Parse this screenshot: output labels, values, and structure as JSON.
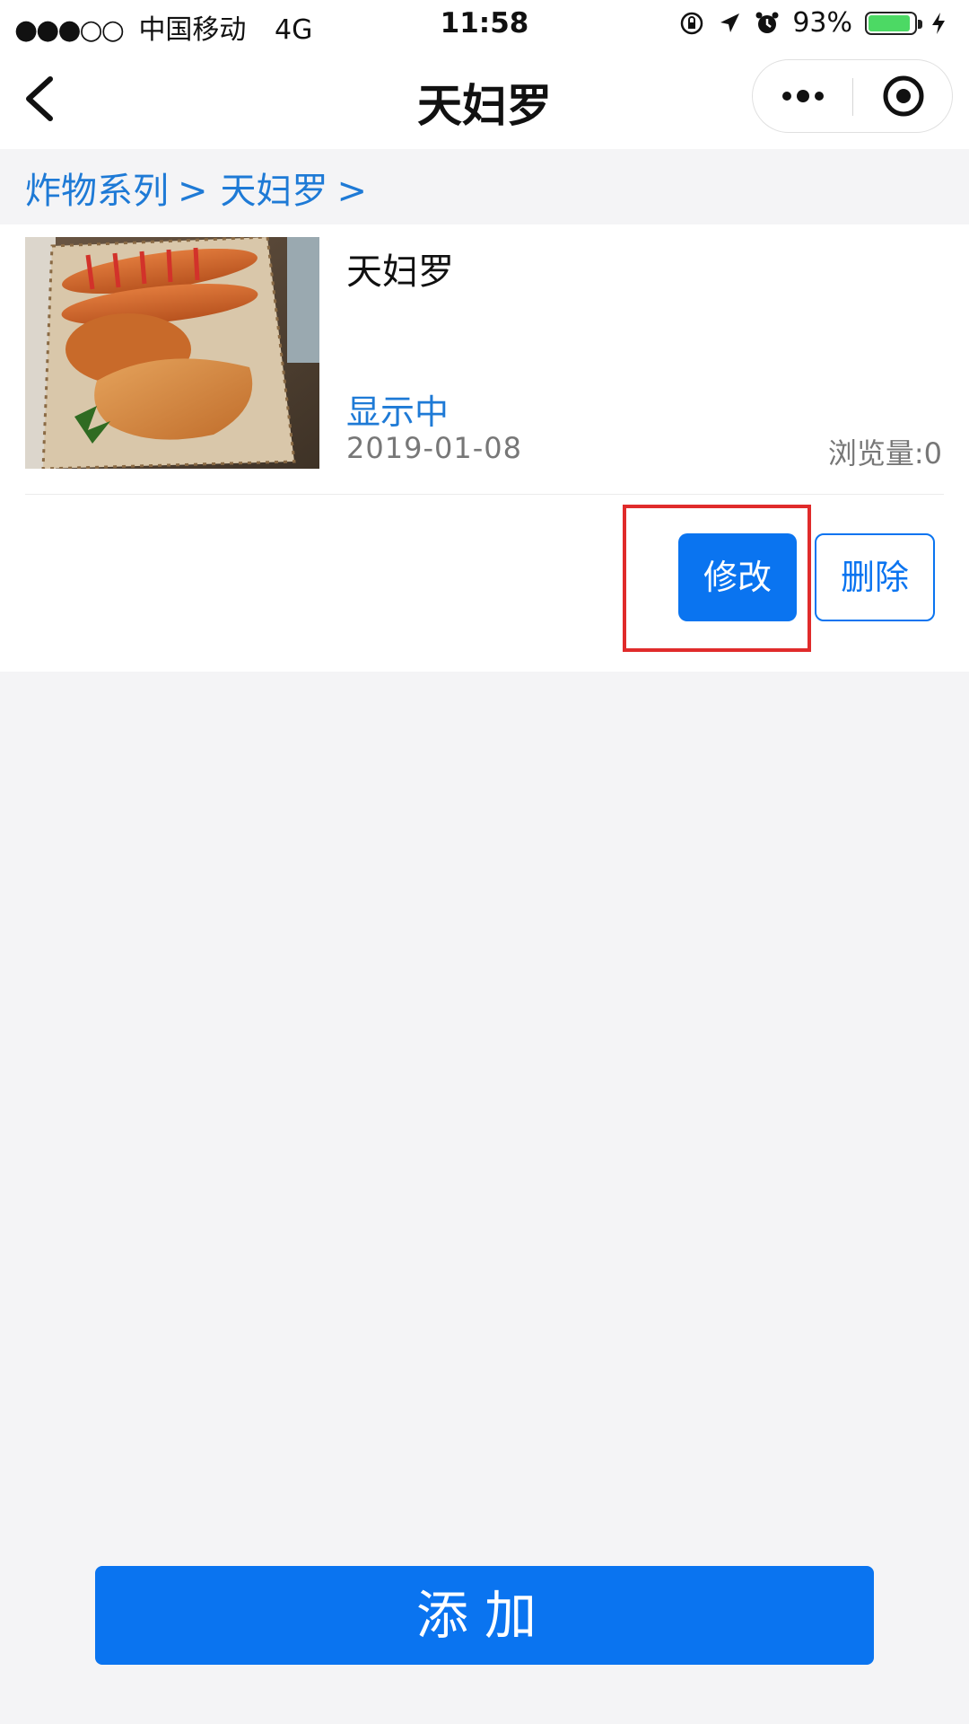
{
  "status_bar": {
    "signal": "●●●○○",
    "carrier": "中国移动",
    "network": "4G",
    "time": "11:58",
    "battery_percent": "93%",
    "battery_level": 0.93
  },
  "nav": {
    "title": "天妇罗"
  },
  "breadcrumb": {
    "items": [
      "炸物系列",
      "天妇罗"
    ],
    "separator": ">"
  },
  "item": {
    "title": "天妇罗",
    "status": "显示中",
    "date": "2019-01-08",
    "views": "浏览量:0"
  },
  "actions": {
    "edit_label": "修改",
    "delete_label": "删除"
  },
  "footer": {
    "add_label": "添加"
  },
  "colors": {
    "primary": "#0a74f0",
    "link": "#1e7ad6",
    "highlight": "#e02b2b",
    "battery": "#4cd964"
  }
}
